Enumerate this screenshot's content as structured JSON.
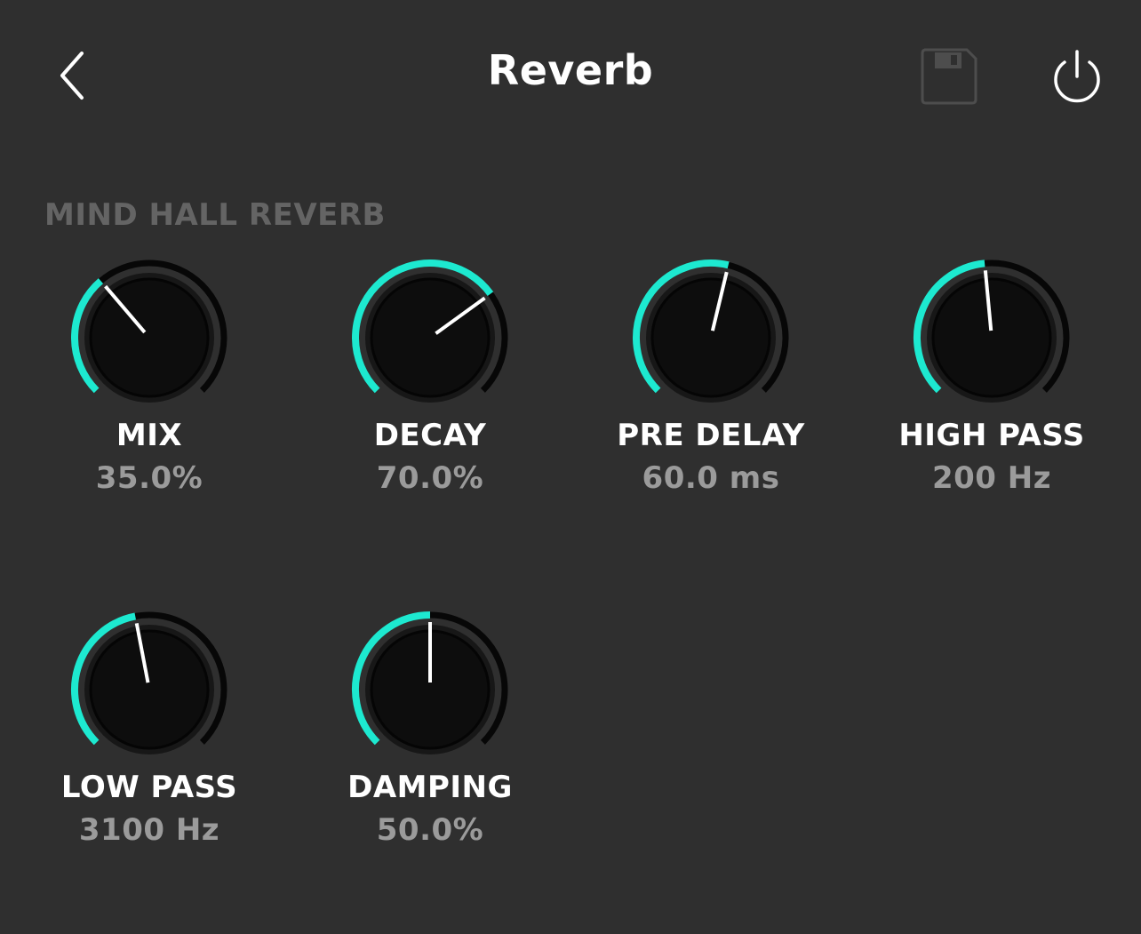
{
  "header": {
    "title": "Reverb",
    "back_icon": "chevron-left-icon",
    "save_icon": "floppy-disk-icon",
    "power_icon": "power-icon"
  },
  "section": {
    "title": "MIND HALL REVERB"
  },
  "colors": {
    "accent": "#1de9d0",
    "track": "#070707",
    "knob_body": "#0d0d0d",
    "pointer": "#ffffff",
    "background": "#2f2f2f"
  },
  "knobs": [
    {
      "label": "MIX",
      "value": "35.0%",
      "level": 0.35
    },
    {
      "label": "DECAY",
      "value": "70.0%",
      "level": 0.7
    },
    {
      "label": "PRE DELAY",
      "value": "60.0 ms",
      "level": 0.55
    },
    {
      "label": "HIGH PASS",
      "value": "200 Hz",
      "level": 0.48
    },
    {
      "label": "LOW PASS",
      "value": "3100 Hz",
      "level": 0.46
    },
    {
      "label": "DAMPING",
      "value": "50.0%",
      "level": 0.5
    }
  ]
}
